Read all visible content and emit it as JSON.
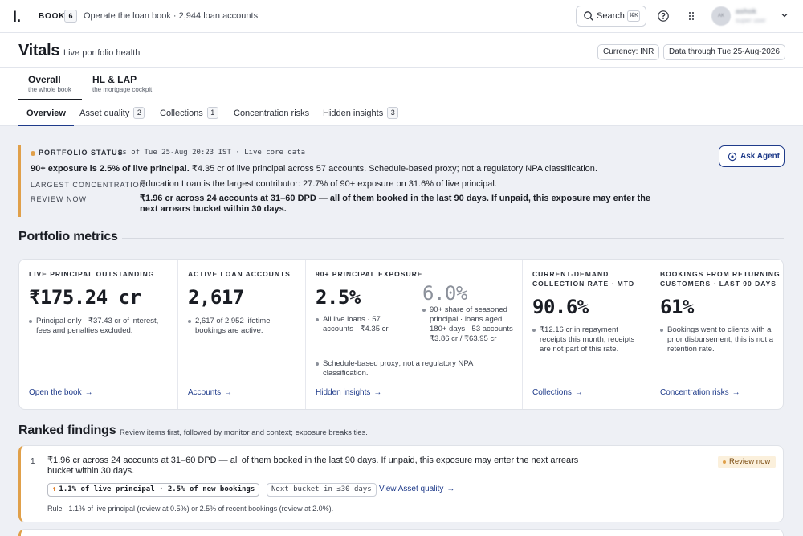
{
  "topbar": {
    "logo": "l.",
    "book_label": "BOOK",
    "book_count": "6",
    "book_description": "Operate the loan book · 2,944 loan accounts",
    "search_label": "Search",
    "search_shortcut": "⌘K",
    "user": {
      "initials": "AK",
      "name": "ashok",
      "role": "super user"
    }
  },
  "header": {
    "title": "Vitals",
    "subtitle": "Live portfolio health",
    "currency": "Currency: INR",
    "data_through": "Data through Tue 25-Aug-2026"
  },
  "book_tabs": [
    {
      "title": "Overall",
      "subtitle": "the whole book",
      "active": true
    },
    {
      "title": "HL & LAP",
      "subtitle": "the mortgage cockpit",
      "active": false
    }
  ],
  "sub_tabs": [
    {
      "label": "Overview",
      "count": ""
    },
    {
      "label": "Asset quality",
      "count": "2"
    },
    {
      "label": "Collections",
      "count": "1"
    },
    {
      "label": "Concentration risks",
      "count": ""
    },
    {
      "label": "Hidden insights",
      "count": "3"
    }
  ],
  "status": {
    "title": "PORTFOLIO STATUS",
    "as_of": "as of Tue 25-Aug 20:23 IST · Live core data",
    "headline_bold": "90+ exposure is 2.5% of live principal.",
    "headline_rest": " ₹4.35 cr of live principal across 57 accounts. Schedule-based proxy; not a regulatory NPA classification.",
    "largest_label": "LARGEST CONCENTRATION",
    "largest_value": "Education Loan is the largest contributor: 27.7% of 90+ exposure on 31.6% of live principal.",
    "review_label": "REVIEW NOW",
    "review_value": "₹1.96 cr across 24 accounts at 31–60 DPD — all of them booked in the last 90 days. If unpaid, this exposure may enter the next arrears bucket within 30 days.",
    "ask_agent": "Ask Agent"
  },
  "metrics_title": "Portfolio metrics",
  "metrics": [
    {
      "label": "LIVE PRINCIPAL OUTSTANDING",
      "value": "₹175.24 cr",
      "note": "Principal only · ₹37.43 cr of interest, fees and penalties excluded.",
      "link": "Open the book"
    },
    {
      "label": "ACTIVE LOAN ACCOUNTS",
      "value": "2,617",
      "note": "2,617 of 2,952 lifetime bookings are active.",
      "link": "Accounts"
    },
    {
      "label": "90+ PRINCIPAL EXPOSURE",
      "value": "2.5%",
      "note": "All live loans · 57 accounts · ₹4.35 cr",
      "secondary_value": "6.0%",
      "secondary_note": "90+ share of seasoned principal · loans aged 180+ days · 53 accounts · ₹3.86 cr / ₹63.95 cr",
      "footnote": "Schedule-based proxy; not a regulatory NPA classification.",
      "link": "Hidden insights"
    },
    {
      "label": "CURRENT-DEMAND COLLECTION RATE · MTD",
      "value": "90.6%",
      "note": "₹12.16 cr in repayment receipts this month; receipts are not part of this rate.",
      "link": "Collections"
    },
    {
      "label": "BOOKINGS FROM RETURNING CUSTOMERS · LAST 90 DAYS",
      "value": "61%",
      "note": "Bookings went to clients with a prior disbursement; this is not a retention rate.",
      "link": "Concentration risks"
    }
  ],
  "findings": {
    "title": "Ranked findings",
    "subtitle": "Review items first, followed by monitor and context; exposure breaks ties.",
    "items": [
      {
        "rank": "1",
        "text": "₹1.96 cr across 24 accounts at 31–60 DPD — all of them booked in the last 90 days. If unpaid, this exposure may enter the next arrears bucket within 30 days.",
        "badge": "Review now",
        "chip_primary": "1.1% of live principal · 2.5% of new bookings",
        "chip_secondary": "Next bucket in ≤30 days",
        "link": "View Asset quality",
        "rule": "Rule · 1.1% of live principal (review at 0.5%) or 2.5% of recent bookings (review at 2.0%)."
      }
    ]
  },
  "colors": {
    "accent": "#1f3b8a",
    "warning": "#e0a04a",
    "background": "#eef0f5"
  },
  "icons": [
    "search-icon",
    "help-icon",
    "apps-grid-icon",
    "chevron-down-icon",
    "agent-target-icon",
    "arrow-right-icon",
    "arrow-up-icon"
  ]
}
